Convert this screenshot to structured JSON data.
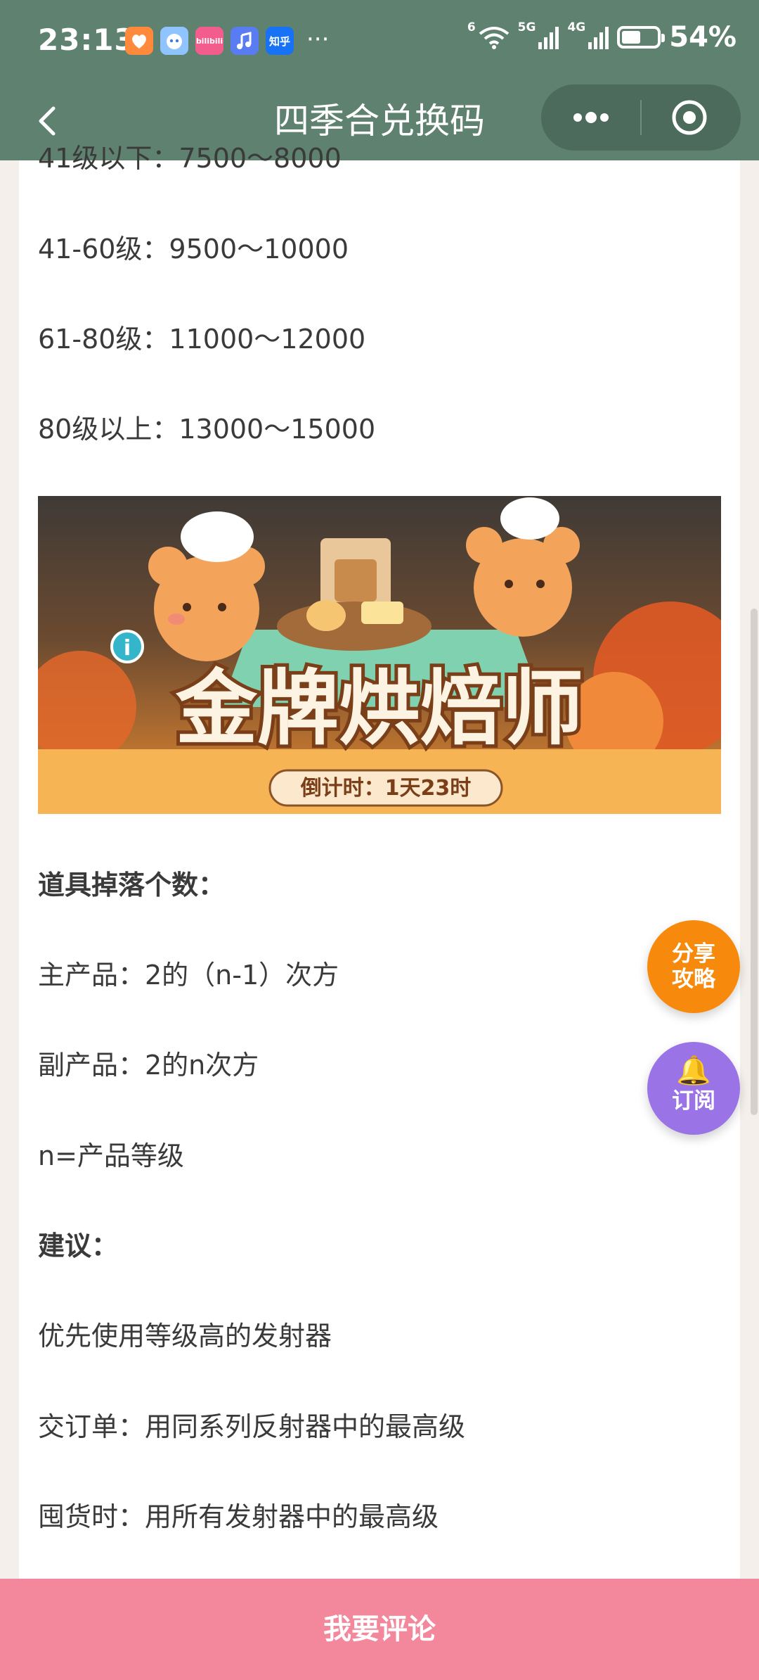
{
  "status_bar": {
    "time": "23:13",
    "app_icons": [
      "health-app-icon",
      "robot-app-icon",
      "bilibili-icon",
      "music-app-icon",
      "zhihu-icon"
    ],
    "bilibili_label": "bilibili",
    "zhihu_label": "知乎",
    "more_notifications": "···",
    "wifi_label": "6",
    "network_5g": "5G",
    "network_4g": "4G",
    "battery_percent": "54%",
    "battery_level": 0.54
  },
  "nav": {
    "title": "四季合兑换码"
  },
  "article": {
    "lines_top": [
      "41级以下：7500～8000",
      "41-60级：9500～10000",
      "61-80级：11000～12000",
      "80级以上：13000～15000"
    ],
    "banner": {
      "title": "金牌烘焙师",
      "countdown": "倒计时：1天23时",
      "info_badge": "i"
    },
    "drop_heading": "道具掉落个数：",
    "main_product": "主产品：2的（n-1）次方",
    "sub_product": "副产品：2的n次方",
    "n_def": "n=产品等级",
    "advice_heading": "建议：",
    "advice_1": "优先使用等级高的发射器",
    "advice_2": "交订单：用同系列反射器中的最高级",
    "advice_3": "囤货时：用所有发射器中的最高级"
  },
  "fab": {
    "share_line1": "分享",
    "share_line2": "攻略",
    "subscribe": "订阅"
  },
  "bottom_bar": {
    "comment_label": "我要评论"
  },
  "colors": {
    "header_bg": "#5e8170",
    "share_fab": "#f78a0d",
    "subscribe_fab": "#9a73e6",
    "comment_bar": "#f3879b"
  }
}
